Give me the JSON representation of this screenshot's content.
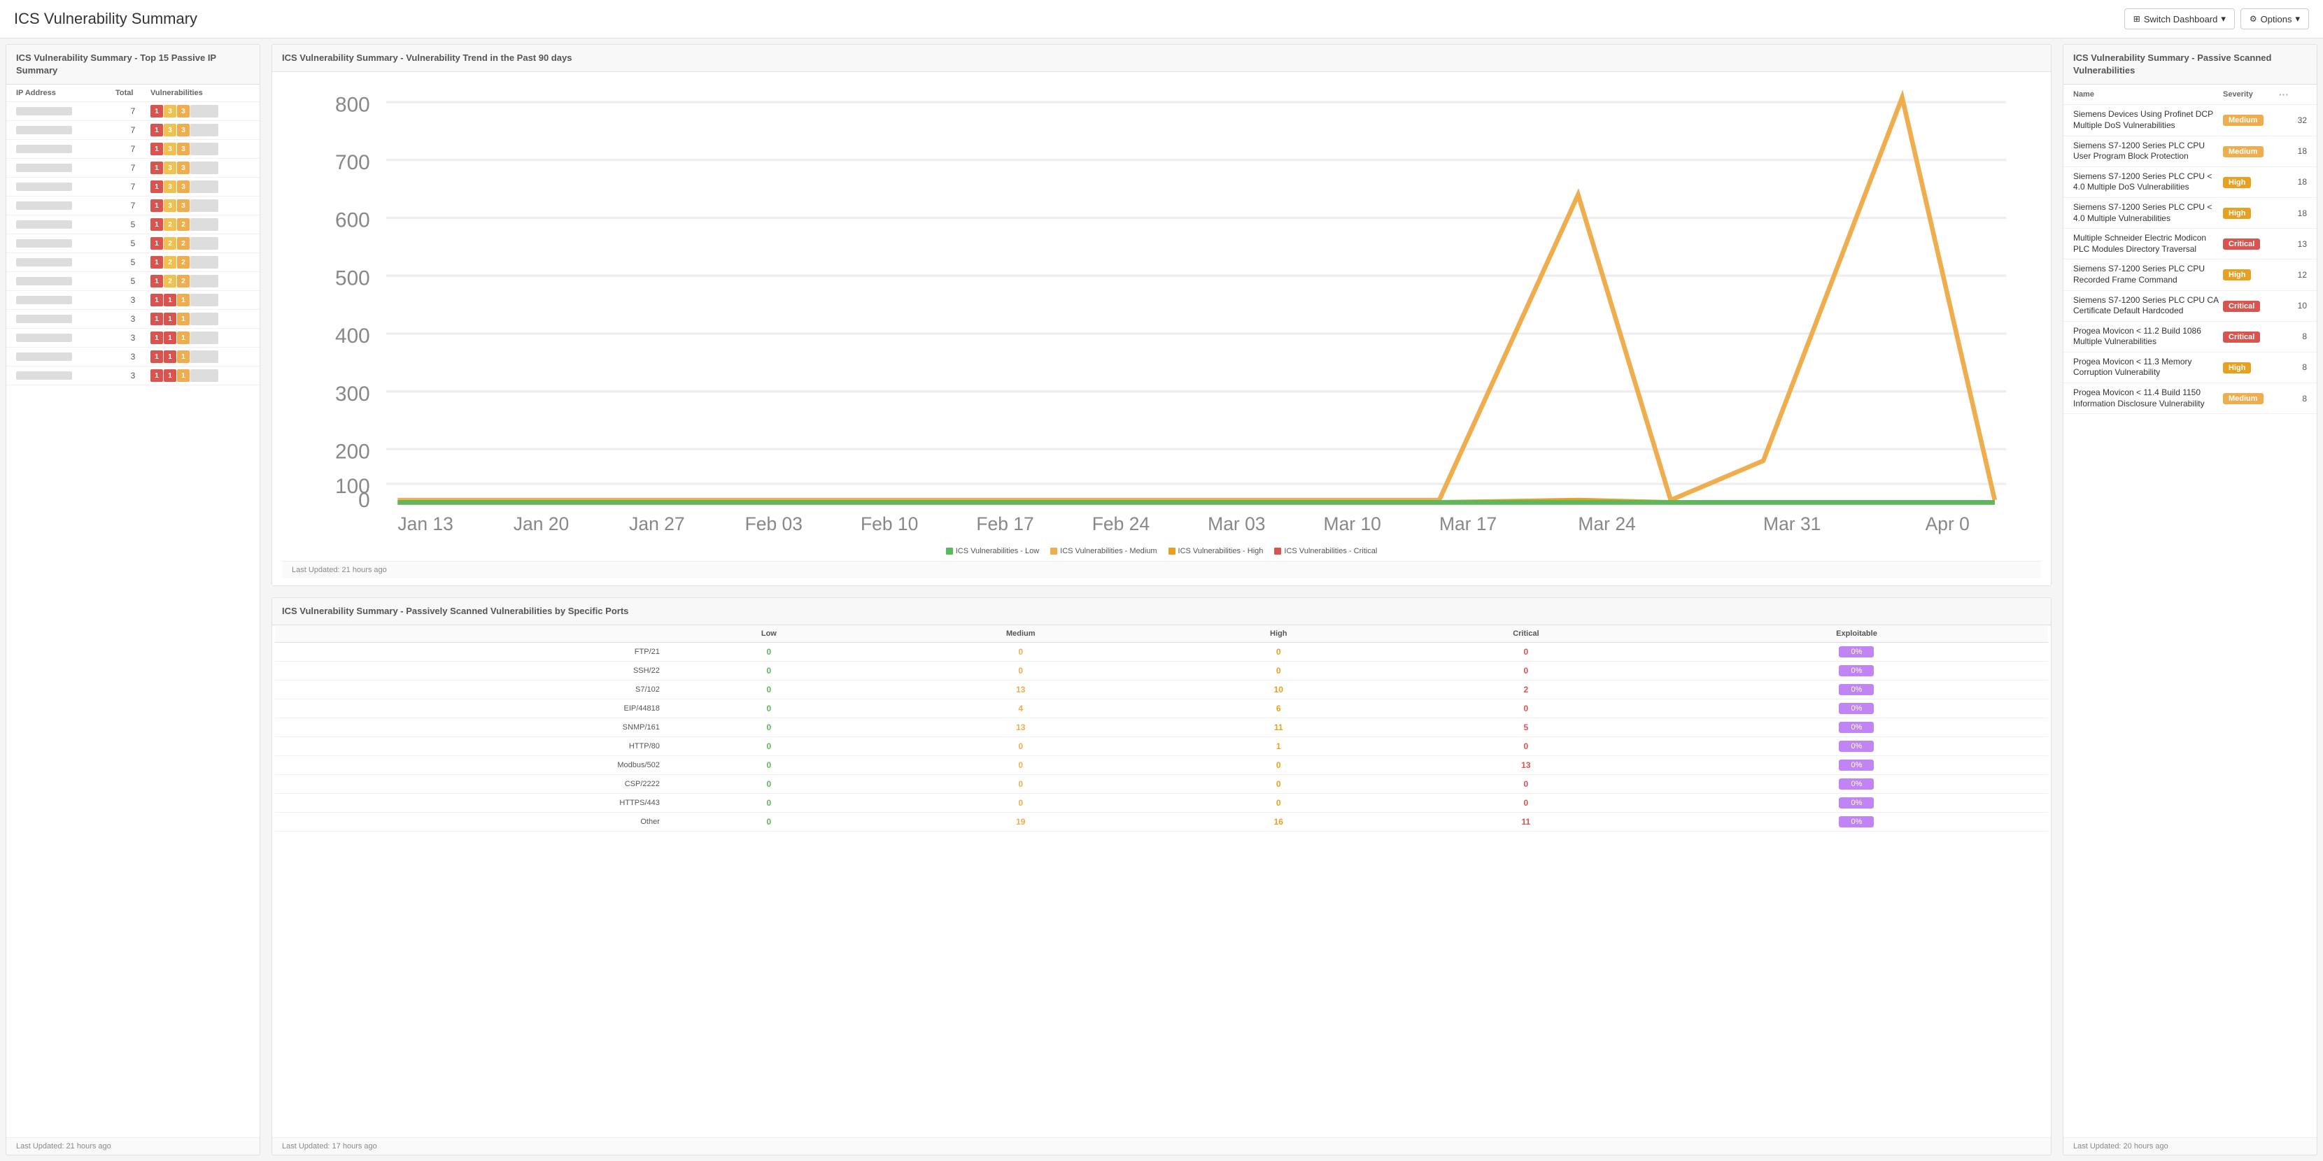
{
  "header": {
    "title": "ICS Vulnerability Summary",
    "switch_dashboard": "Switch Dashboard",
    "options": "Options"
  },
  "left_panel": {
    "title": "ICS Vulnerability Summary - Top 15 Passive IP Summary",
    "columns": [
      "IP Address",
      "Total",
      "Vulnerabilities"
    ],
    "rows": [
      {
        "total": 7,
        "bars": [
          {
            "type": "critical",
            "val": "1"
          },
          {
            "type": "medium",
            "val": "3"
          },
          {
            "type": "high",
            "val": "3"
          },
          {
            "type": "empty",
            "val": ""
          }
        ]
      },
      {
        "total": 7,
        "bars": [
          {
            "type": "critical",
            "val": "1"
          },
          {
            "type": "medium",
            "val": "3"
          },
          {
            "type": "high",
            "val": "3"
          },
          {
            "type": "empty",
            "val": ""
          }
        ]
      },
      {
        "total": 7,
        "bars": [
          {
            "type": "critical",
            "val": "1"
          },
          {
            "type": "medium",
            "val": "3"
          },
          {
            "type": "high",
            "val": "3"
          },
          {
            "type": "empty",
            "val": ""
          }
        ]
      },
      {
        "total": 7,
        "bars": [
          {
            "type": "critical",
            "val": "1"
          },
          {
            "type": "medium",
            "val": "3"
          },
          {
            "type": "high",
            "val": "3"
          },
          {
            "type": "empty",
            "val": ""
          }
        ]
      },
      {
        "total": 7,
        "bars": [
          {
            "type": "critical",
            "val": "1"
          },
          {
            "type": "medium",
            "val": "3"
          },
          {
            "type": "high",
            "val": "3"
          },
          {
            "type": "empty",
            "val": ""
          }
        ]
      },
      {
        "total": 7,
        "bars": [
          {
            "type": "critical",
            "val": "1"
          },
          {
            "type": "medium",
            "val": "3"
          },
          {
            "type": "high",
            "val": "3"
          },
          {
            "type": "empty",
            "val": ""
          }
        ]
      },
      {
        "total": 5,
        "bars": [
          {
            "type": "critical",
            "val": "1"
          },
          {
            "type": "medium",
            "val": "2"
          },
          {
            "type": "high",
            "val": "2"
          },
          {
            "type": "empty",
            "val": ""
          }
        ]
      },
      {
        "total": 5,
        "bars": [
          {
            "type": "critical",
            "val": "1"
          },
          {
            "type": "medium",
            "val": "2"
          },
          {
            "type": "high",
            "val": "2"
          },
          {
            "type": "empty",
            "val": ""
          }
        ]
      },
      {
        "total": 5,
        "bars": [
          {
            "type": "critical",
            "val": "1"
          },
          {
            "type": "medium",
            "val": "2"
          },
          {
            "type": "high",
            "val": "2"
          },
          {
            "type": "empty",
            "val": ""
          }
        ]
      },
      {
        "total": 5,
        "bars": [
          {
            "type": "critical",
            "val": "1"
          },
          {
            "type": "medium",
            "val": "2"
          },
          {
            "type": "high",
            "val": "2"
          },
          {
            "type": "empty",
            "val": ""
          }
        ]
      },
      {
        "total": 3,
        "bars": [
          {
            "type": "critical",
            "val": "1"
          },
          {
            "type": "critical",
            "val": "1"
          },
          {
            "type": "high",
            "val": "1"
          },
          {
            "type": "empty",
            "val": ""
          }
        ]
      },
      {
        "total": 3,
        "bars": [
          {
            "type": "critical",
            "val": "1"
          },
          {
            "type": "critical",
            "val": "1"
          },
          {
            "type": "high",
            "val": "1"
          },
          {
            "type": "empty",
            "val": ""
          }
        ]
      },
      {
        "total": 3,
        "bars": [
          {
            "type": "critical",
            "val": "1"
          },
          {
            "type": "critical",
            "val": "1"
          },
          {
            "type": "high",
            "val": "1"
          },
          {
            "type": "empty",
            "val": ""
          }
        ]
      },
      {
        "total": 3,
        "bars": [
          {
            "type": "critical",
            "val": "1"
          },
          {
            "type": "critical",
            "val": "1"
          },
          {
            "type": "high",
            "val": "1"
          },
          {
            "type": "empty",
            "val": ""
          }
        ]
      },
      {
        "total": 3,
        "bars": [
          {
            "type": "critical",
            "val": "1"
          },
          {
            "type": "critical",
            "val": "1"
          },
          {
            "type": "high",
            "val": "1"
          },
          {
            "type": "empty",
            "val": ""
          }
        ]
      }
    ],
    "footer": "Last Updated: 21 hours ago"
  },
  "chart_panel": {
    "title": "ICS Vulnerability Summary - Vulnerability Trend in the Past 90 days",
    "y_labels": [
      "800",
      "700",
      "600",
      "500",
      "400",
      "300",
      "200",
      "100",
      "0"
    ],
    "x_labels": [
      "Jan 13",
      "Jan 20",
      "Jan 27",
      "Feb 03",
      "Feb 10",
      "Feb 17",
      "Feb 24",
      "Mar 03",
      "Mar 10",
      "Mar 17",
      "Mar 24",
      "Mar 31",
      "Apr 0"
    ],
    "legend": [
      {
        "label": "ICS Vulnerabilities - Low",
        "color": "#5cb85c"
      },
      {
        "label": "ICS Vulnerabilities - Medium",
        "color": "#f0ad4e"
      },
      {
        "label": "ICS Vulnerabilities - High",
        "color": "#e8a020"
      },
      {
        "label": "ICS Vulnerabilities - Critical",
        "color": "#d9534f"
      }
    ],
    "footer": "Last Updated: 21 hours ago"
  },
  "ports_panel": {
    "title": "ICS Vulnerability Summary - Passively Scanned Vulnerabilities by Specific Ports",
    "columns": [
      "",
      "Low",
      "Medium",
      "High",
      "Critical",
      "Exploitable"
    ],
    "rows": [
      {
        "port": "FTP/21",
        "low": "0",
        "medium": "0",
        "high": "0",
        "critical": "0",
        "exploit": "0%"
      },
      {
        "port": "SSH/22",
        "low": "0",
        "medium": "0",
        "high": "0",
        "critical": "0",
        "exploit": "0%"
      },
      {
        "port": "S7/102",
        "low": "0",
        "medium": "13",
        "high": "10",
        "critical": "2",
        "exploit": "0%"
      },
      {
        "port": "EIP/44818",
        "low": "0",
        "medium": "4",
        "high": "6",
        "critical": "0",
        "exploit": "0%"
      },
      {
        "port": "SNMP/161",
        "low": "0",
        "medium": "13",
        "high": "11",
        "critical": "5",
        "exploit": "0%"
      },
      {
        "port": "HTTP/80",
        "low": "0",
        "medium": "0",
        "high": "1",
        "critical": "0",
        "exploit": "0%"
      },
      {
        "port": "Modbus/502",
        "low": "0",
        "medium": "0",
        "high": "0",
        "critical": "13",
        "exploit": "0%"
      },
      {
        "port": "CSP/2222",
        "low": "0",
        "medium": "0",
        "high": "0",
        "critical": "0",
        "exploit": "0%"
      },
      {
        "port": "HTTPS/443",
        "low": "0",
        "medium": "0",
        "high": "0",
        "critical": "0",
        "exploit": "0%"
      },
      {
        "port": "Other",
        "low": "0",
        "medium": "19",
        "high": "16",
        "critical": "11",
        "exploit": "0%"
      }
    ],
    "footer": "Last Updated: 17 hours ago"
  },
  "right_panel": {
    "title": "ICS Vulnerability Summary - Passive Scanned Vulnerabilities",
    "columns": [
      "Name",
      "Severity",
      "..."
    ],
    "rows": [
      {
        "name": "Siemens Devices Using Profinet DCP Multiple DoS Vulnerabilities",
        "severity": "Medium",
        "count": "32"
      },
      {
        "name": "Siemens S7-1200 Series PLC CPU User Program Block Protection",
        "severity": "Medium",
        "count": "18"
      },
      {
        "name": "Siemens S7-1200 Series PLC CPU < 4.0 Multiple DoS Vulnerabilities",
        "severity": "High",
        "count": "18"
      },
      {
        "name": "Siemens S7-1200 Series PLC CPU < 4.0 Multiple Vulnerabilities",
        "severity": "High",
        "count": "18"
      },
      {
        "name": "Multiple Schneider Electric Modicon PLC Modules Directory Traversal",
        "severity": "Critical",
        "count": "13"
      },
      {
        "name": "Siemens S7-1200 Series PLC CPU Recorded Frame Command",
        "severity": "High",
        "count": "12"
      },
      {
        "name": "Siemens S7-1200 Series PLC CPU CA Certificate Default Hardcoded",
        "severity": "Critical",
        "count": "10"
      },
      {
        "name": "Progea Movicon < 11.2 Build 1086 Multiple Vulnerabilities",
        "severity": "Critical",
        "count": "8"
      },
      {
        "name": "Progea Movicon < 11.3 Memory Corruption Vulnerability",
        "severity": "High",
        "count": "8"
      },
      {
        "name": "Progea Movicon < 11.4 Build 1150 Information Disclosure Vulnerability",
        "severity": "Medium",
        "count": "8"
      }
    ],
    "footer": "Last Updated: 20 hours ago"
  }
}
